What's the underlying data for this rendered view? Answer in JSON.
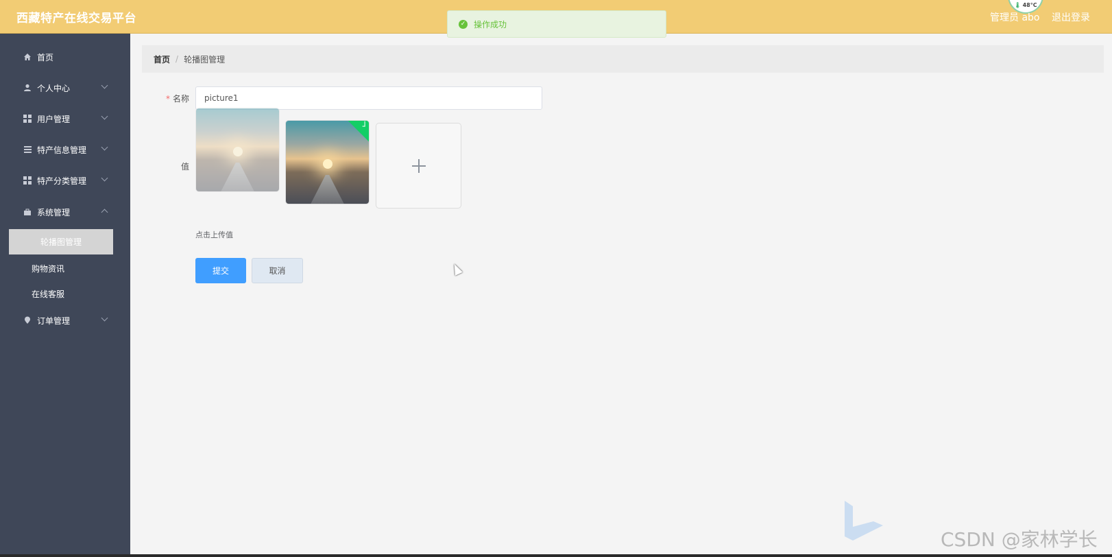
{
  "header": {
    "title": "西藏特产在线交易平台",
    "user": "管理员 abo",
    "logout": "退出登录",
    "temp": "48°C"
  },
  "toast": {
    "message": "操作成功"
  },
  "sidebar": {
    "items": [
      {
        "label": "首页",
        "icon": "home-icon"
      },
      {
        "label": "个人中心",
        "icon": "user-icon"
      },
      {
        "label": "用户管理",
        "icon": "grid-icon"
      },
      {
        "label": "特产信息管理",
        "icon": "list-icon"
      },
      {
        "label": "特产分类管理",
        "icon": "grid-icon"
      },
      {
        "label": "系统管理",
        "icon": "briefcase-icon"
      },
      {
        "label": "订单管理",
        "icon": "location-pin-icon"
      }
    ],
    "submenu": [
      {
        "label": "轮播图管理",
        "active": true
      },
      {
        "label": "购物资讯",
        "active": false
      },
      {
        "label": "在线客服",
        "active": false
      }
    ]
  },
  "breadcrumb": {
    "home": "首页",
    "separator": "/",
    "current": "轮播图管理"
  },
  "form": {
    "name_label": "名称",
    "name_value": "picture1",
    "value_label": "值",
    "upload_tip": "点击上传值",
    "submit": "提交",
    "cancel": "取消"
  },
  "watermark": "CSDN @家林学长",
  "colors": {
    "header_bg": "#f2cc74",
    "sidebar_bg": "#3f4758",
    "primary": "#409eff",
    "success": "#67c23a"
  }
}
